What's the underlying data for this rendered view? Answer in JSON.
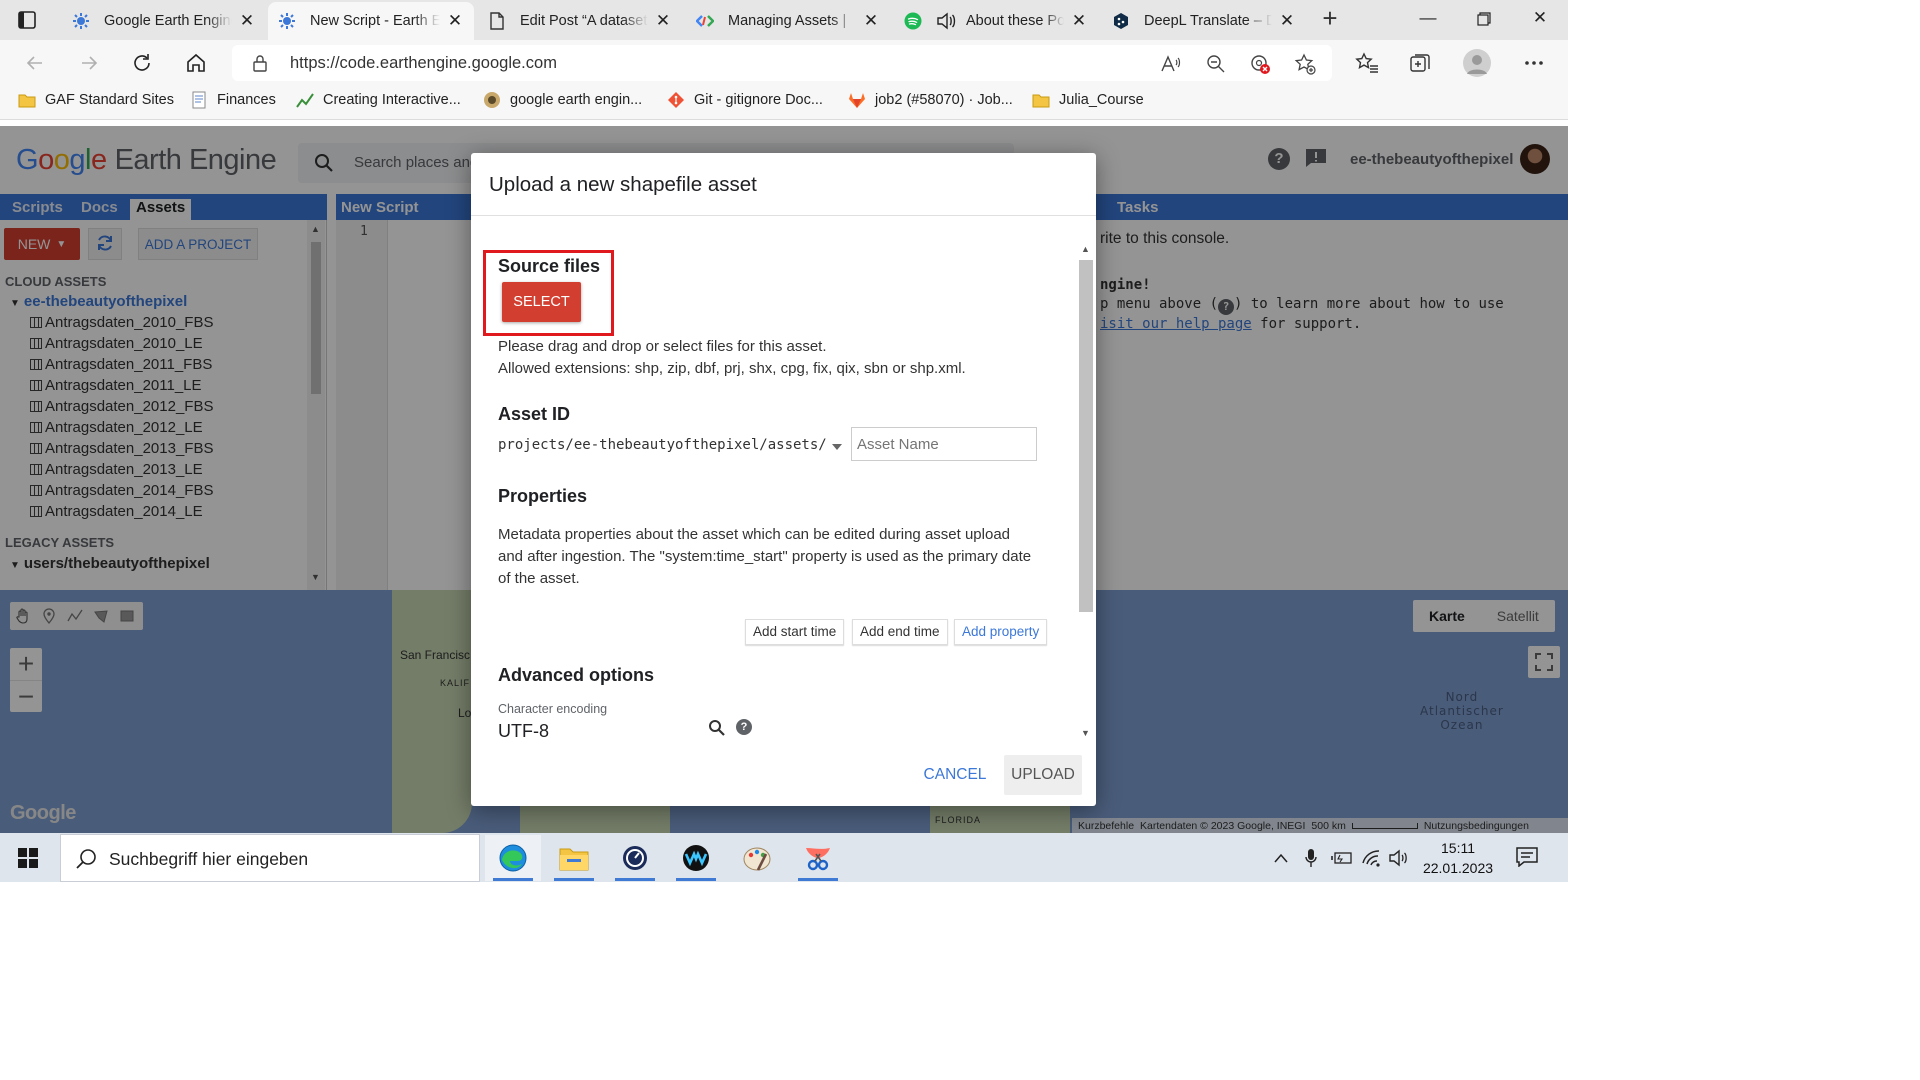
{
  "browser": {
    "tabs": [
      {
        "title": "Google Earth Engine",
        "icon": "earth-engine-icon",
        "active": false
      },
      {
        "title": "New Script - Earth Engine",
        "icon": "earth-engine-icon",
        "active": true
      },
      {
        "title": "Edit Post “A dataset",
        "icon": "document-icon",
        "active": false
      },
      {
        "title": "Managing Assets |",
        "icon": "google-dev-icon",
        "active": false
      },
      {
        "title": "About these Po",
        "icon": "spotify-icon",
        "active": false
      },
      {
        "title": "DeepL Translate – D",
        "icon": "deepl-icon",
        "active": false
      }
    ],
    "url": "https://code.earthengine.google.com",
    "bookmarks": [
      {
        "label": "GAF Standard Sites",
        "icon": "folder-icon"
      },
      {
        "label": "Finances",
        "icon": "doc-icon"
      },
      {
        "label": "Creating Interactive...",
        "icon": "chart-icon"
      },
      {
        "label": "google earth engin...",
        "icon": "gee-icon"
      },
      {
        "label": "Git - gitignore Doc...",
        "icon": "git-icon"
      },
      {
        "label": "job2 (#58070) · Job...",
        "icon": "gitlab-icon"
      },
      {
        "label": "Julia_Course",
        "icon": "folder-icon"
      }
    ]
  },
  "gee": {
    "logo_google": "Google",
    "logo_product": "Earth Engine",
    "search_placeholder": "Search places and datasets...",
    "username": "ee-thebeautyofthepixel",
    "left_tabs": [
      "Scripts",
      "Docs",
      "Assets"
    ],
    "new_label": "NEW",
    "add_project_label": "ADD A PROJECT",
    "cloud_assets_heading": "CLOUD ASSETS",
    "cloud_root": "ee-thebeautyofthepixel",
    "assets": [
      "Antragsdaten_2010_FBS",
      "Antragsdaten_2010_LE",
      "Antragsdaten_2011_FBS",
      "Antragsdaten_2011_LE",
      "Antragsdaten_2012_FBS",
      "Antragsdaten_2012_LE",
      "Antragsdaten_2013_FBS",
      "Antragsdaten_2013_LE",
      "Antragsdaten_2014_FBS",
      "Antragsdaten_2014_LE"
    ],
    "legacy_heading": "LEGACY ASSETS",
    "legacy_root": "users/thebeautyofthepixel",
    "editor_tab": "New Script",
    "editor_line": "1",
    "console_tab": "Tasks",
    "console_line1": "rite to this console.",
    "console_line2": "ngine!",
    "console_line3a": "p menu above (",
    "console_line3b": ") to learn more about how to use",
    "console_line4_link": "isit our help page",
    "console_line4_rest": " for support."
  },
  "map": {
    "labels": {
      "sf": "San Francisc",
      "kalif": "KALIF",
      "lo": "Lo",
      "florida": "FLORIDA"
    },
    "ocean_lines": [
      "Nord",
      "Atlantischer",
      "Ozean"
    ],
    "map_type_map": "Karte",
    "map_type_satellite": "Satellit",
    "google_mark": "Google",
    "attribution": {
      "shortcuts": "Kurzbefehle",
      "mapdata": "Kartendaten © 2023 Google, INEGI",
      "scale": "500 km",
      "terms": "Nutzungsbedingungen"
    }
  },
  "dialog": {
    "title": "Upload a new shapefile asset",
    "source_files_label": "Source files",
    "select_label": "SELECT",
    "drag_text": "Please drag and drop or select files for this asset.",
    "extensions_text": "Allowed extensions: shp, zip, dbf, prj, shx, cpg, fix, qix, sbn or shp.xml.",
    "asset_id_label": "Asset ID",
    "asset_prefix": "projects/ee-thebeautyofthepixel/assets/",
    "asset_name_placeholder": "Asset Name",
    "properties_label": "Properties",
    "properties_text_1": "Metadata properties about the asset which can be edited during asset upload",
    "properties_text_2": "and after ingestion. The \"system:time_start\" property is used as the primary date",
    "properties_text_3": "of the asset.",
    "add_start_time": "Add start time",
    "add_end_time": "Add end time",
    "add_property": "Add property",
    "advanced_label": "Advanced options",
    "encoding_label": "Character encoding",
    "encoding_value": "UTF-8",
    "cancel_label": "CANCEL",
    "upload_label": "UPLOAD"
  },
  "taskbar": {
    "search_placeholder": "Suchbegriff hier eingeben",
    "time": "15:11",
    "date": "22.01.2023"
  },
  "colors": {
    "accent_blue": "#3c78d8",
    "action_red": "#d23f31",
    "highlight_red": "#e0191f"
  }
}
